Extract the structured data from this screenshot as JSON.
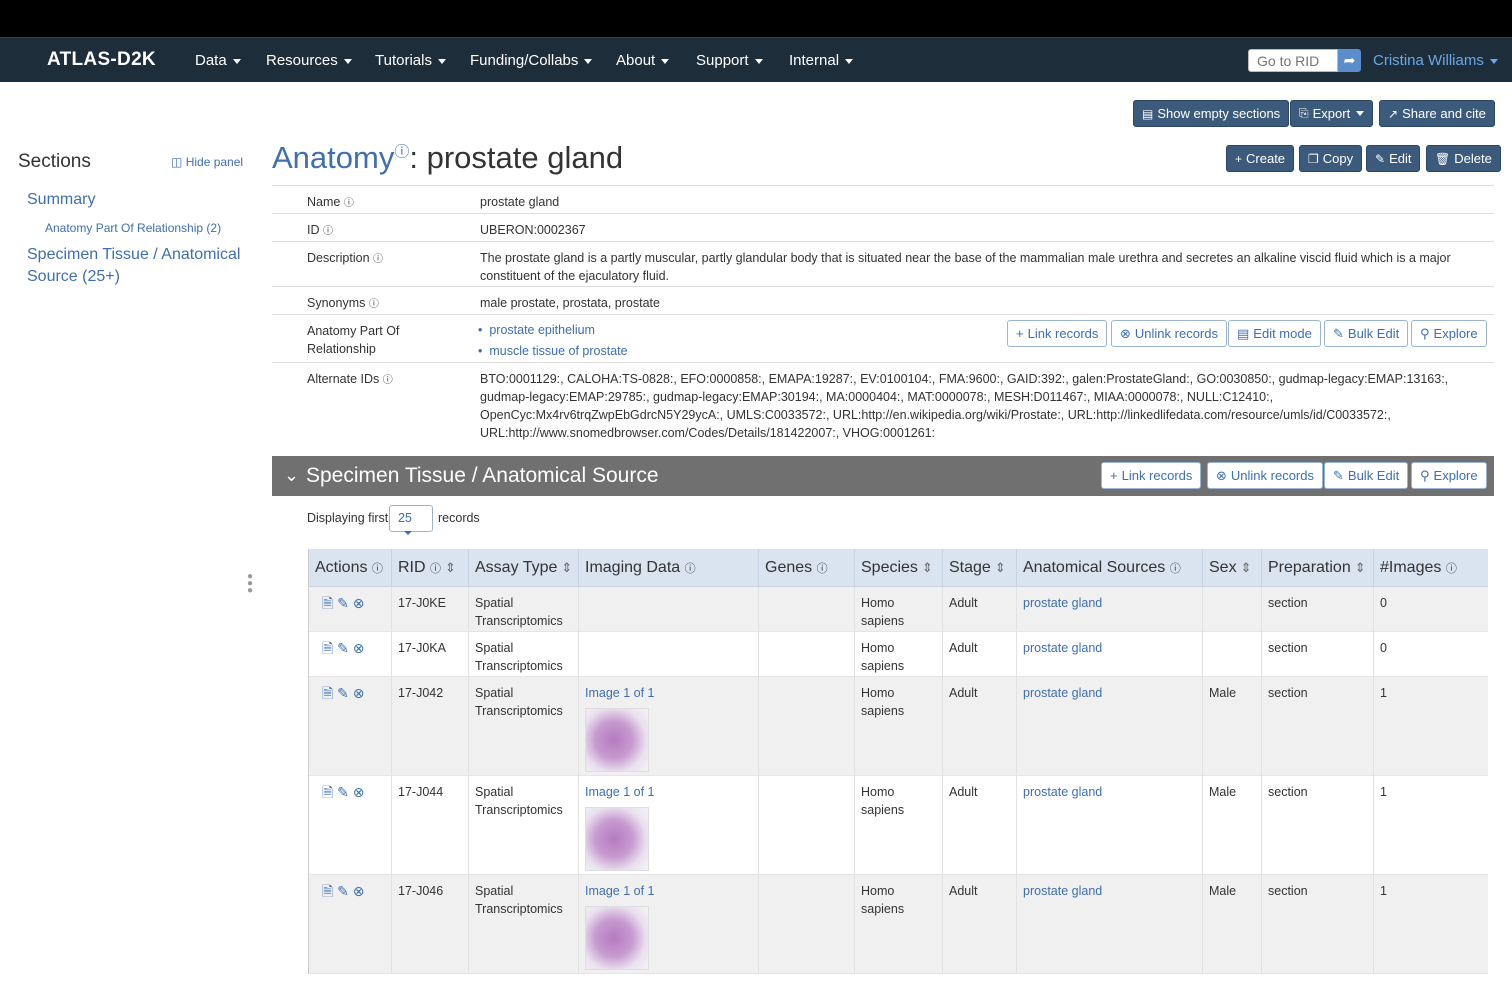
{
  "nav": {
    "brand": "ATLAS-D2K",
    "items": [
      "Data",
      "Resources",
      "Tutorials",
      "Funding/Collabs",
      "About",
      "Support",
      "Internal"
    ],
    "rid_placeholder": "Go to RID",
    "user": "Cristina Williams"
  },
  "toolbar": {
    "show_empty": "Show empty sections",
    "export": "Export",
    "share": "Share and cite",
    "create": "Create",
    "copy": "Copy",
    "edit": "Edit",
    "delete": "Delete"
  },
  "sidebar": {
    "title": "Sections",
    "hide_panel": "Hide panel",
    "items": [
      {
        "label": "Summary"
      },
      {
        "label": "Anatomy Part Of Relationship (2)"
      },
      {
        "label": "Specimen Tissue / Anatomical Source (25+)"
      }
    ]
  },
  "page": {
    "table_name": "Anatomy",
    "info_glyph": "ⓘ",
    "record_name": ": prostate gland"
  },
  "record": {
    "name_key": "Name",
    "name_val": "prostate gland",
    "id_key": "ID",
    "id_val": "UBERON:0002367",
    "desc_key": "Description",
    "desc_val": "The prostate gland is a partly muscular, partly glandular body that is situated near the base of the mammalian male urethra and secretes an alkaline viscid fluid which is a major constituent of the ejaculatory fluid.",
    "syn_key": "Synonyms",
    "syn_val": "male prostate, prostata, prostate",
    "rel_key": "Anatomy Part Of Relationship",
    "rel_items": [
      "prostate epithelium",
      "muscle tissue of prostate"
    ],
    "alt_key": "Alternate IDs",
    "alt_val": "BTO:0001129:, CALOHA:TS-0828:, EFO:0000858:, EMAPA:19287:, EV:0100104:, FMA:9600:, GAID:392:, galen:ProstateGland:, GO:0030850:, gudmap-legacy:EMAP:13163:, gudmap-legacy:EMAP:29785:, gudmap-legacy:EMAP:30194:, MA:0000404:, MAT:0000078:, MESH:D011467:, MIAA:0000078:, NULL:C12410:, OpenCyc:Mx4rv6trqZwpEbGdrcN5Y29ycA:, UMLS:C0033572:, URL:http://en.wikipedia.org/wiki/Prostate:, URL:http://linkedlifedata.com/resource/umls/id/C0033572:, URL:http://www.snomedbrowser.com/Codes/Details/181422007:, VHOG:0001261:"
  },
  "rel_buttons": {
    "link": "Link records",
    "unlink": "Unlink records",
    "edit_mode": "Edit mode",
    "bulk_edit": "Bulk Edit",
    "explore": "Explore"
  },
  "section": {
    "title": "Specimen Tissue / Anatomical Source",
    "link": "Link records",
    "unlink": "Unlink records",
    "bulk_edit": "Bulk Edit",
    "explore": "Explore",
    "displaying": "Displaying first",
    "page_size": "25",
    "records": "records"
  },
  "grid": {
    "headers": [
      "Actions",
      "RID",
      "Assay Type",
      "Imaging Data",
      "Genes",
      "Species",
      "Stage",
      "Anatomical Sources",
      "Sex",
      "Preparation",
      "#Images"
    ],
    "rows": [
      {
        "rid": "17-J0KE",
        "assay": "Spatial Transcriptomics",
        "imaging": "",
        "species": "Homo sapiens",
        "stage": "Adult",
        "source": "prostate gland",
        "sex": "",
        "prep": "section",
        "images": "0"
      },
      {
        "rid": "17-J0KA",
        "assay": "Spatial Transcriptomics",
        "imaging": "",
        "species": "Homo sapiens",
        "stage": "Adult",
        "source": "prostate gland",
        "sex": "",
        "prep": "section",
        "images": "0"
      },
      {
        "rid": "17-J042",
        "assay": "Spatial Transcriptomics",
        "imaging": "Image 1 of 1",
        "species": "Homo sapiens",
        "stage": "Adult",
        "source": "prostate gland",
        "sex": "Male",
        "prep": "section",
        "images": "1"
      },
      {
        "rid": "17-J044",
        "assay": "Spatial Transcriptomics",
        "imaging": "Image 1 of 1",
        "species": "Homo sapiens",
        "stage": "Adult",
        "source": "prostate gland",
        "sex": "Male",
        "prep": "section",
        "images": "1"
      },
      {
        "rid": "17-J046",
        "assay": "Spatial Transcriptomics",
        "imaging": "Image 1 of 1",
        "species": "Homo sapiens",
        "stage": "Adult",
        "source": "prostate gland",
        "sex": "Male",
        "prep": "section",
        "images": "1"
      }
    ]
  }
}
